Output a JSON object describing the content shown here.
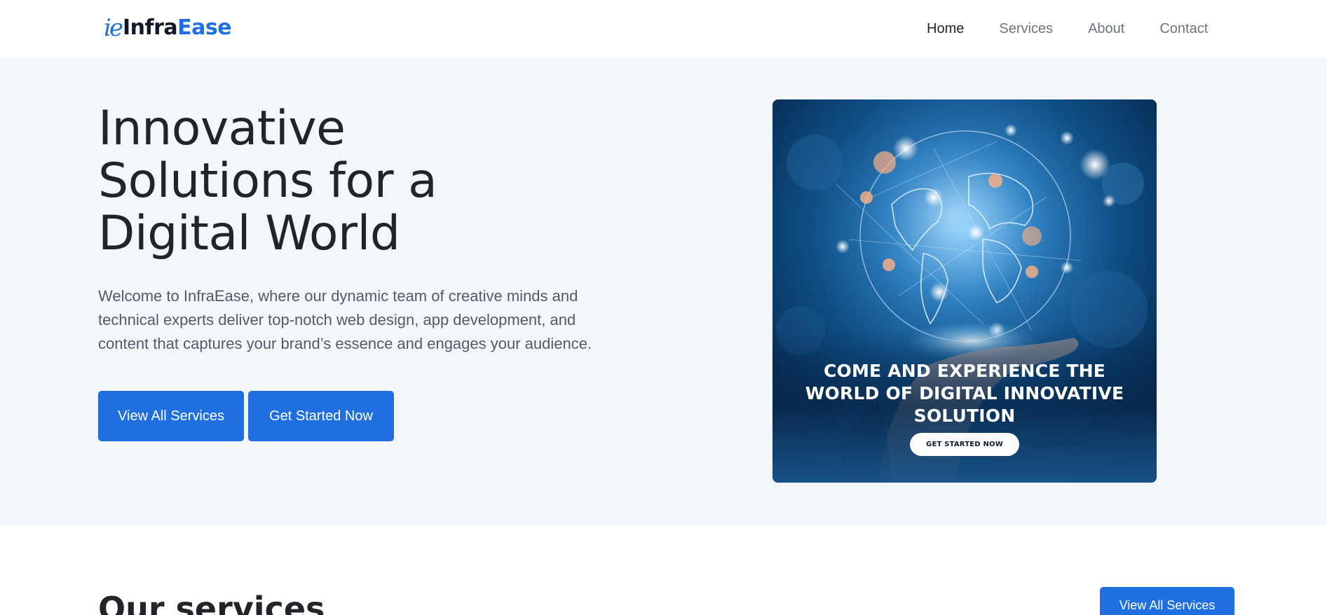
{
  "header": {
    "brand_mark": "ie",
    "brand_infra": "Infra",
    "brand_ease": "Ease",
    "nav": [
      {
        "label": "Home",
        "active": true
      },
      {
        "label": "Services",
        "active": false
      },
      {
        "label": "About",
        "active": false
      },
      {
        "label": "Contact",
        "active": false
      }
    ]
  },
  "hero": {
    "title": "Innovative Solutions for a Digital World",
    "text": "Welcome to InfraEase, where our dynamic team of creative minds and technical experts deliver top-notch web design, app development, and content that captures your brand’s essence and engages your audience.",
    "btn_view": "View All Services",
    "btn_start": "Get Started Now"
  },
  "promo": {
    "headline": "COME AND EXPERIENCE THE WORLD OF DIGITAL INNOVATIVE SOLUTION",
    "button": "GET STARTED NOW"
  },
  "services": {
    "title": "Our services",
    "btn_view": "View All Services"
  },
  "colors": {
    "accent": "#1f6fe0",
    "hero_bg": "#f3f6fa",
    "text": "#212529",
    "muted": "#6c757d"
  }
}
